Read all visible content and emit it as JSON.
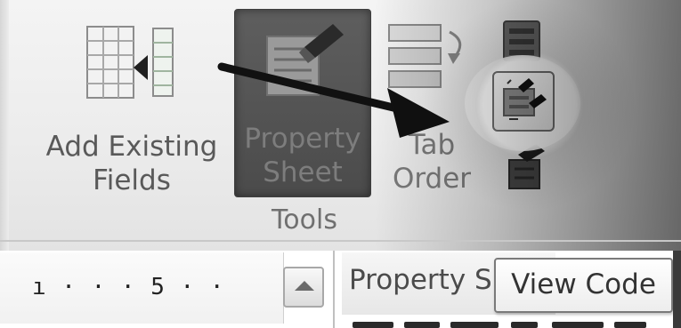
{
  "ribbon": {
    "add_existing_fields": {
      "label_line1": "Add Existing",
      "label_line2": "Fields",
      "icon": "add-existing-fields-icon"
    },
    "property_sheet": {
      "label_line1": "Property",
      "label_line2": "Sheet",
      "icon": "property-sheet-icon",
      "state": "pressed"
    },
    "tab_order": {
      "label_line1": "Tab",
      "label_line2": "Order",
      "icon": "tab-order-icon"
    },
    "view_code": {
      "icon": "view-code-icon",
      "highlighted": true
    },
    "group_label": "Tools"
  },
  "ruler": {
    "text": "ı · · · 5 · ·"
  },
  "property_pane": {
    "title": "Property Sheet"
  },
  "tooltip": {
    "text": "View Code"
  },
  "annotation": {
    "arrow_color": "#111111"
  }
}
